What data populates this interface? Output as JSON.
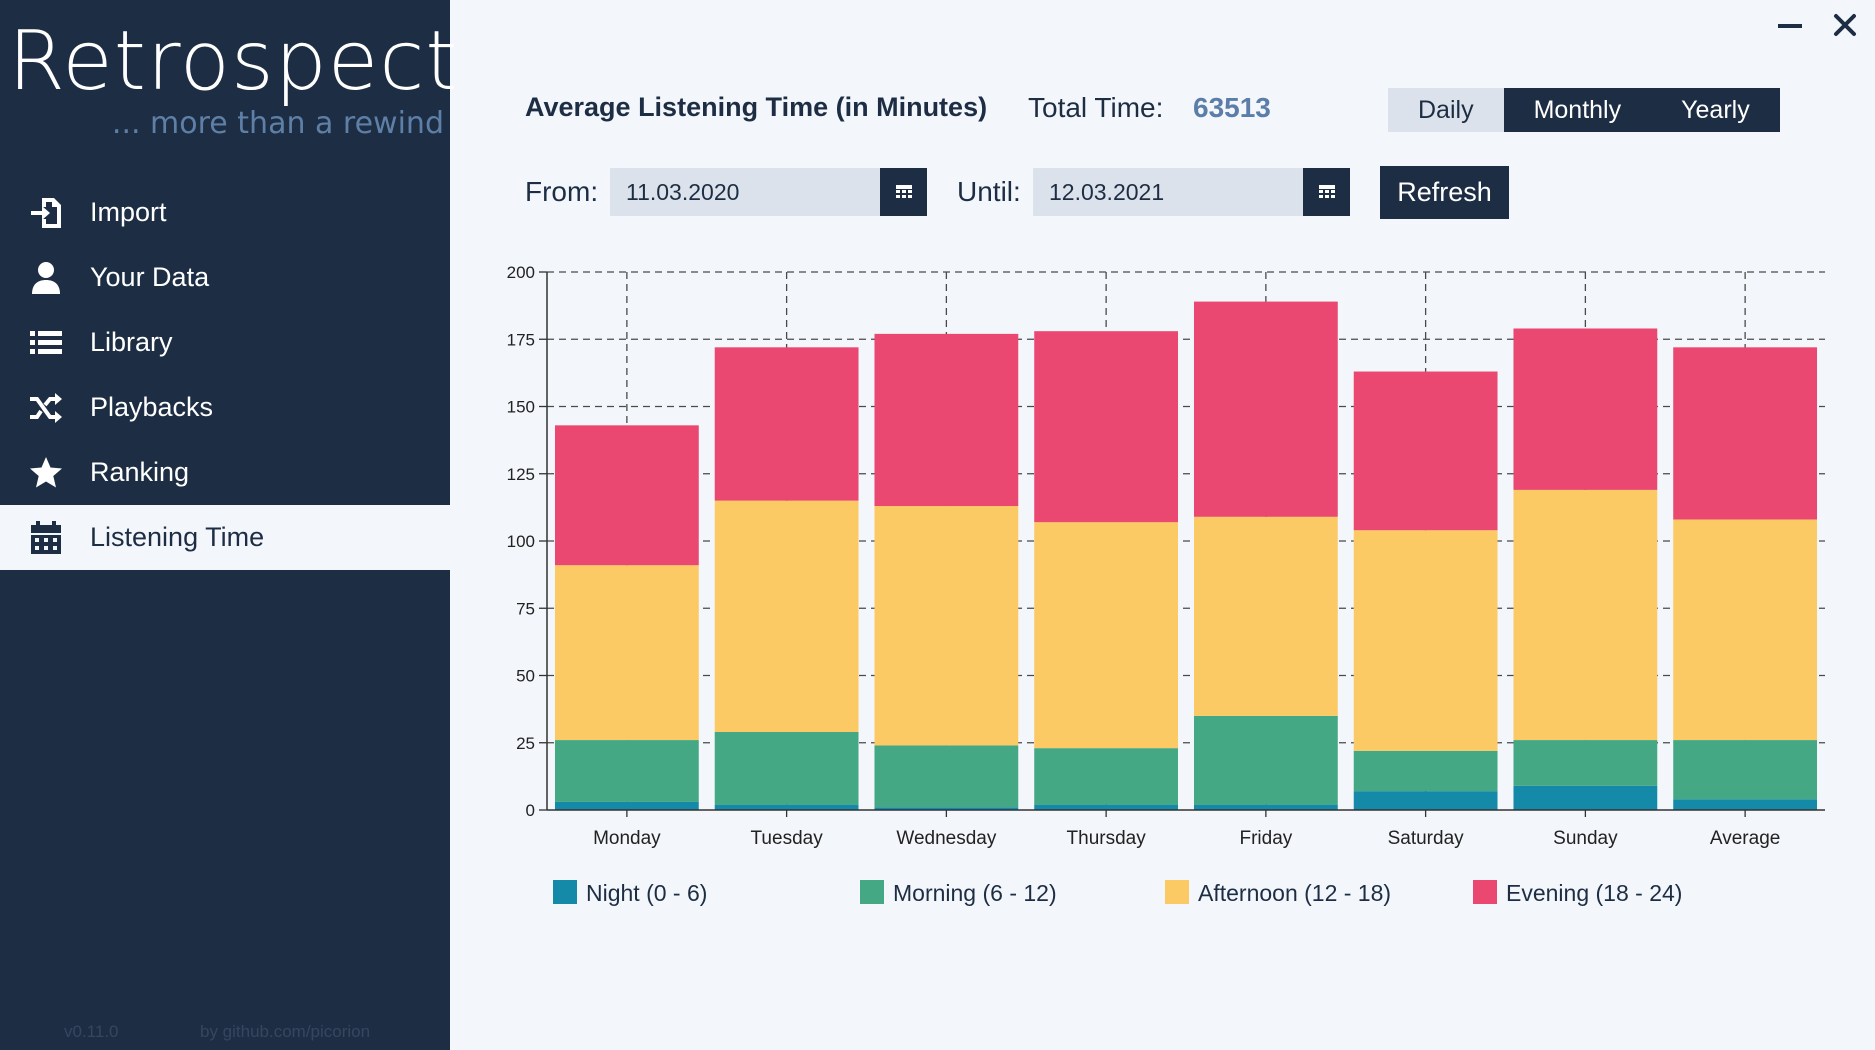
{
  "app": {
    "name": "Retrospect",
    "tagline": "... more than a rewind",
    "version": "v0.11.0",
    "credit": "by github.com/picorion"
  },
  "colors": {
    "sidebar_bg": "#1d2e44",
    "content_bg": "#f3f6fb",
    "accent_text": "#5a7ea8",
    "night": "#1589a8",
    "morning": "#44a884",
    "afternoon": "#fbca64",
    "evening": "#ea4870"
  },
  "sidebar": {
    "items": [
      {
        "label": "Import",
        "icon": "import-icon",
        "active": false
      },
      {
        "label": "Your Data",
        "icon": "user-icon",
        "active": false
      },
      {
        "label": "Library",
        "icon": "list-icon",
        "active": false
      },
      {
        "label": "Playbacks",
        "icon": "shuffle-icon",
        "active": false
      },
      {
        "label": "Ranking",
        "icon": "star-icon",
        "active": false
      },
      {
        "label": "Listening Time",
        "icon": "calendar-icon",
        "active": true
      }
    ]
  },
  "header": {
    "title": "Average Listening Time (in Minutes)",
    "total_label": "Total Time:",
    "total_value": "63513",
    "period_options": [
      "Daily",
      "Monthly",
      "Yearly"
    ],
    "selected_period": "Daily"
  },
  "filters": {
    "from_label": "From:",
    "from_value": "11.03.2020",
    "until_label": "Until:",
    "until_value": "12.03.2021",
    "refresh_label": "Refresh"
  },
  "chart_data": {
    "type": "bar",
    "stacked": true,
    "categories": [
      "Monday",
      "Tuesday",
      "Wednesday",
      "Thursday",
      "Friday",
      "Saturday",
      "Sunday",
      "Average"
    ],
    "series": [
      {
        "name": "Night (0 - 6)",
        "color": "#1589a8",
        "values": [
          3,
          2,
          1,
          2,
          2,
          7,
          9,
          4
        ]
      },
      {
        "name": "Morning (6 - 12)",
        "color": "#44a884",
        "values": [
          23,
          27,
          23,
          21,
          33,
          15,
          17,
          22
        ]
      },
      {
        "name": "Afternoon (12 - 18)",
        "color": "#fbca64",
        "values": [
          65,
          86,
          89,
          84,
          74,
          82,
          93,
          82
        ]
      },
      {
        "name": "Evening (18 - 24)",
        "color": "#ea4870",
        "values": [
          52,
          57,
          64,
          71,
          80,
          59,
          60,
          64
        ]
      }
    ],
    "ylim": [
      0,
      200
    ],
    "yticks": [
      0,
      25,
      50,
      75,
      100,
      125,
      150,
      175,
      200
    ],
    "grid": true,
    "legend": "bottom"
  }
}
